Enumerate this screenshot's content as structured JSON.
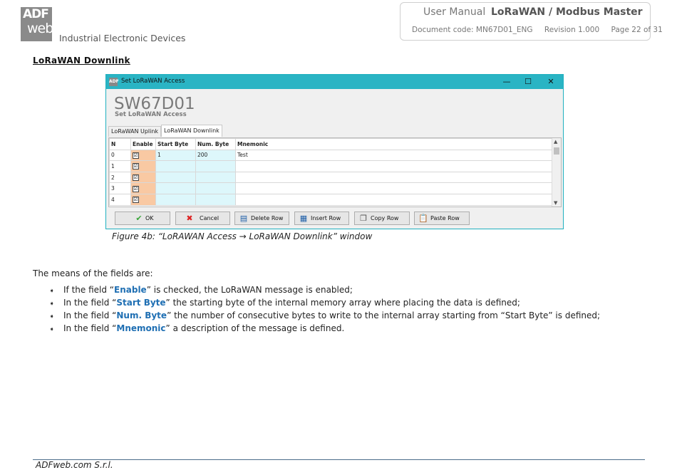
{
  "header": {
    "logo_top": "ADF",
    "logo_bottom": "web",
    "company_subtitle": "Industrial Electronic Devices",
    "manual_label": "User Manual",
    "product": "LoRaWAN / Modbus Master",
    "doc_code": "Document code: MN67D01_ENG",
    "revision": "Revision 1.000",
    "page": "Page 22 of 31"
  },
  "section_title": "LoRaWAN Downlink",
  "window": {
    "icon_text": "ADF",
    "title": "Set LoRaWAN Access",
    "minimize": "—",
    "maximize": "☐",
    "close": "✕",
    "brand": "SW67D01",
    "brand_sub": "Set LoRaWAN Access",
    "tabs": [
      "LoRaWAN Uplink",
      "LoRaWAN Downlink"
    ],
    "active_tab": "LoRaWAN Downlink",
    "columns": [
      "N",
      "Enable",
      "Start Byte",
      "Num. Byte",
      "Mnemonic"
    ],
    "rows": [
      {
        "n": "0",
        "enable": "☑",
        "start": "1",
        "num": "200",
        "mnemonic": "Test"
      },
      {
        "n": "1",
        "enable": "☑",
        "start": "",
        "num": "",
        "mnemonic": ""
      },
      {
        "n": "2",
        "enable": "☑",
        "start": "",
        "num": "",
        "mnemonic": ""
      },
      {
        "n": "3",
        "enable": "☑",
        "start": "",
        "num": "",
        "mnemonic": ""
      },
      {
        "n": "4",
        "enable": "☑",
        "start": "",
        "num": "",
        "mnemonic": ""
      }
    ],
    "buttons": {
      "ok": "OK",
      "cancel": "Cancel",
      "delete_row": "Delete Row",
      "insert_row": "Insert Row",
      "copy_row": "Copy Row",
      "paste_row": "Paste Row"
    }
  },
  "caption": "Figure 4b: “LoRAWAN Access → LoRaWAN Downlink” window",
  "intro": "The means of the fields are:",
  "fields": [
    {
      "pre": "If the field “",
      "name": "Enable",
      "post": "” is checked, the LoRaWAN message is enabled;"
    },
    {
      "pre": "In the field “",
      "name": "Start Byte",
      "post": "” the starting byte of the internal memory array where placing the data is defined;"
    },
    {
      "pre": "In the field “",
      "name": "Num. Byte",
      "post": "” the number of consecutive bytes to write to the internal array starting from “Start Byte” is defined;"
    },
    {
      "pre": "In the field “",
      "name": "Mnemonic",
      "post": "” a description of the message is defined."
    }
  ],
  "footer": "ADFweb.com S.r.l.",
  "colors": {
    "titlebar": "#2ab4c4",
    "enable_col": "#f9c9a3",
    "byte_cols": "#ddf7fb",
    "field_name": "#1f6fb3"
  }
}
